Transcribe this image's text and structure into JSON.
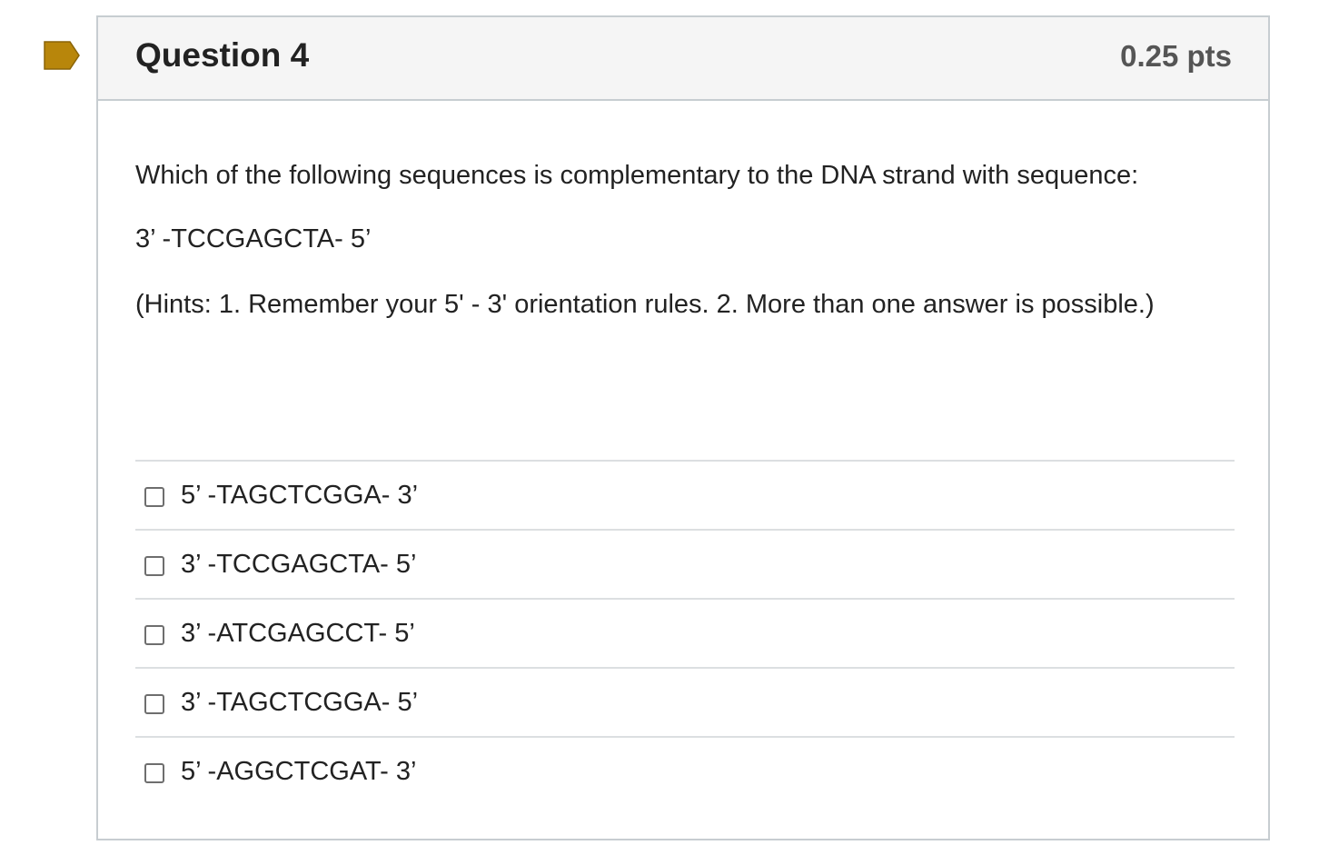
{
  "colors": {
    "flag": "#b8860b",
    "header_bg": "#f5f5f5",
    "border": "#c7cdd1"
  },
  "flag_icon": "flag-marker-icon",
  "question": {
    "title": "Question 4",
    "points": "0.25 pts",
    "prompt": "Which of the following sequences is complementary to the DNA strand with sequence:",
    "sequence": "3’ -TCCGAGCTA- 5’",
    "hint": "(Hints: 1. Remember your 5' - 3' orientation rules. 2. More than one answer is possible.)"
  },
  "answers": [
    {
      "label": "5’ -TAGCTCGGA- 3’",
      "checked": false
    },
    {
      "label": "3’ -TCCGAGCTA- 5’",
      "checked": false
    },
    {
      "label": "3’ -ATCGAGCCT- 5’",
      "checked": false
    },
    {
      "label": "3’ -TAGCTCGGA- 5’",
      "checked": false
    },
    {
      "label": "5’ -AGGCTCGAT- 3’",
      "checked": false
    }
  ]
}
